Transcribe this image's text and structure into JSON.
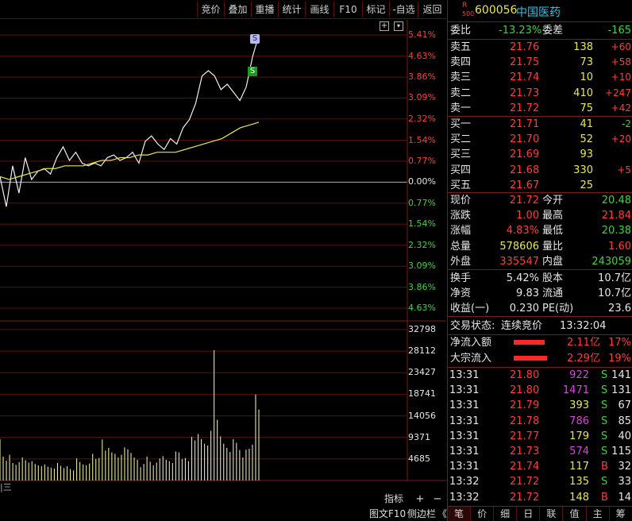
{
  "toolbar": {
    "buttons": [
      "竞价",
      "叠加",
      "重播",
      "统计",
      "画线",
      "F10",
      "标记",
      "-自选",
      "返回"
    ]
  },
  "chart": {
    "price_labels_up": [
      "5.41%",
      "4.63%",
      "3.86%",
      "3.09%",
      "2.32%",
      "1.54%",
      "0.77%",
      "0.00%"
    ],
    "price_labels_down": [
      "0.77%",
      "1.54%",
      "2.32%",
      "3.09%",
      "3.86%",
      "4.63%"
    ],
    "volume_labels": [
      "32798",
      "28112",
      "23427",
      "18741",
      "14056",
      "9371",
      "4685"
    ],
    "markers": [
      "S",
      "S"
    ],
    "corner_icon": "+",
    "settings_icon": "▾"
  },
  "chart_data": {
    "type": "line",
    "series": [
      {
        "values": [
          0.2,
          -0.9,
          0.6,
          -0.4,
          0.9,
          0.1,
          0.4,
          0.5,
          0.3,
          0.9,
          1.3,
          0.8,
          1.1,
          0.7,
          0.6,
          0.7,
          0.6,
          0.9,
          1.0,
          0.8,
          0.9,
          1.1,
          0.7,
          1.5,
          1.7,
          1.4,
          1.2,
          1.6,
          1.4,
          2.0,
          2.3,
          2.9,
          3.9,
          4.1,
          3.9,
          3.4,
          3.6,
          3.3,
          3.0,
          3.5,
          4.6,
          5.41
        ]
      },
      {
        "values": [
          0.2,
          0.1,
          0.2,
          0.3,
          0.4,
          0.5,
          0.5,
          0.6,
          0.6,
          0.6,
          0.7,
          0.8,
          0.8,
          0.9,
          0.9,
          1.0,
          1.0,
          1.1,
          1.1,
          1.1,
          1.2,
          1.3,
          1.4,
          1.5,
          1.6,
          1.8,
          2.0,
          2.1,
          2.2
        ]
      }
    ],
    "volume": [
      9000,
      5200,
      4300,
      5600,
      3800,
      3400,
      4000,
      5000,
      4400,
      3900,
      4200,
      3600,
      3300,
      3100,
      3500,
      3000,
      2800,
      2600,
      3800,
      3200,
      2700,
      3100,
      2500,
      2200,
      4800,
      4000,
      3500,
      3300,
      3700,
      5800,
      4700,
      4900,
      8900,
      6500,
      7100,
      6100,
      5800,
      5000,
      5600,
      7200,
      6800,
      6000,
      5000,
      4500,
      2900,
      3600,
      5200,
      4100,
      3300,
      3900,
      4800,
      5300,
      4500,
      4200,
      3800,
      6300,
      6100,
      4700,
      4900,
      4200,
      9500,
      8700,
      10100,
      9000,
      8000,
      7600,
      10800,
      28300,
      13200,
      9600,
      8000,
      7100,
      6200,
      9000,
      8200,
      6600,
      5000,
      6700,
      6900,
      7800,
      18700,
      15400
    ],
    "ylim": [
      -4.63,
      5.41
    ],
    "volume_max": 32798
  },
  "stock": {
    "badge_r": "R",
    "badge_num": "500",
    "code": "600056",
    "name": "中国医药"
  },
  "ratio": {
    "weibi_label": "委比",
    "weibi": "-13.23%",
    "weicha_label": "委差",
    "weicha": "-165"
  },
  "sells": [
    {
      "label": "卖五",
      "price": "21.76",
      "vol": "138",
      "chg": "+60"
    },
    {
      "label": "卖四",
      "price": "21.75",
      "vol": "73",
      "chg": "+58"
    },
    {
      "label": "卖三",
      "price": "21.74",
      "vol": "10",
      "chg": "+10"
    },
    {
      "label": "卖二",
      "price": "21.73",
      "vol": "410",
      "chg": "+247"
    },
    {
      "label": "卖一",
      "price": "21.72",
      "vol": "75",
      "chg": "+42"
    }
  ],
  "buys": [
    {
      "label": "买一",
      "price": "21.71",
      "vol": "41",
      "chg": "-2"
    },
    {
      "label": "买二",
      "price": "21.70",
      "vol": "52",
      "chg": "+20"
    },
    {
      "label": "买三",
      "price": "21.69",
      "vol": "93",
      "chg": ""
    },
    {
      "label": "买四",
      "price": "21.68",
      "vol": "330",
      "chg": "+5"
    },
    {
      "label": "买五",
      "price": "21.67",
      "vol": "25",
      "chg": ""
    }
  ],
  "quote": [
    {
      "l1": "现价",
      "v1": "21.72",
      "l2": "今开",
      "v2": "20.48"
    },
    {
      "l1": "涨跌",
      "v1": "1.00",
      "l2": "最高",
      "v2": "21.84"
    },
    {
      "l1": "涨幅",
      "v1": "4.83%",
      "l2": "最低",
      "v2": "20.38"
    },
    {
      "l1": "总量",
      "v1": "578606",
      "l2": "量比",
      "v2": "1.60"
    },
    {
      "l1": "外盘",
      "v1": "335547",
      "l2": "内盘",
      "v2": "243059"
    }
  ],
  "stats": [
    {
      "l1": "换手",
      "v1": "5.42%",
      "l2": "股本",
      "v2": "10.7亿"
    },
    {
      "l1": "净资",
      "v1": "9.83",
      "l2": "流通",
      "v2": "10.7亿"
    },
    {
      "l1": "收益(一)",
      "v1": "0.230",
      "l2": "PE(动)",
      "v2": "23.6"
    }
  ],
  "trade_status": {
    "label": "交易状态:",
    "value": "连续竞价",
    "time": "13:32:04"
  },
  "flows": [
    {
      "label": "净流入额",
      "value": "2.11亿",
      "pct": "17%",
      "bar": 0.88
    },
    {
      "label": "大宗流入",
      "value": "2.29亿",
      "pct": "19%",
      "bar": 0.95
    }
  ],
  "ticks": [
    {
      "time": "13:31",
      "price": "21.80",
      "vol": "922",
      "side": "S",
      "n": "141"
    },
    {
      "time": "13:31",
      "price": "21.80",
      "vol": "1471",
      "side": "S",
      "n": "131"
    },
    {
      "time": "13:31",
      "price": "21.79",
      "vol": "393",
      "side": "S",
      "n": "67"
    },
    {
      "time": "13:31",
      "price": "21.78",
      "vol": "786",
      "side": "S",
      "n": "85"
    },
    {
      "time": "13:31",
      "price": "21.77",
      "vol": "179",
      "side": "S",
      "n": "40"
    },
    {
      "time": "13:31",
      "price": "21.73",
      "vol": "574",
      "side": "S",
      "n": "115"
    },
    {
      "time": "13:31",
      "price": "21.74",
      "vol": "117",
      "side": "B",
      "n": "32"
    },
    {
      "time": "13:32",
      "price": "21.72",
      "vol": "135",
      "side": "S",
      "n": "33"
    },
    {
      "time": "13:32",
      "price": "21.72",
      "vol": "148",
      "side": "B",
      "n": "14"
    }
  ],
  "bottom": {
    "indicator": "指标",
    "plus": "+",
    "minus": "−",
    "tuwen": "图文F10",
    "sidebar": "侧边栏",
    "sidebar_arrow": "《",
    "corner": "|三"
  },
  "tabs": [
    "笔",
    "价",
    "细",
    "日",
    "联",
    "值",
    "主",
    "筹"
  ]
}
